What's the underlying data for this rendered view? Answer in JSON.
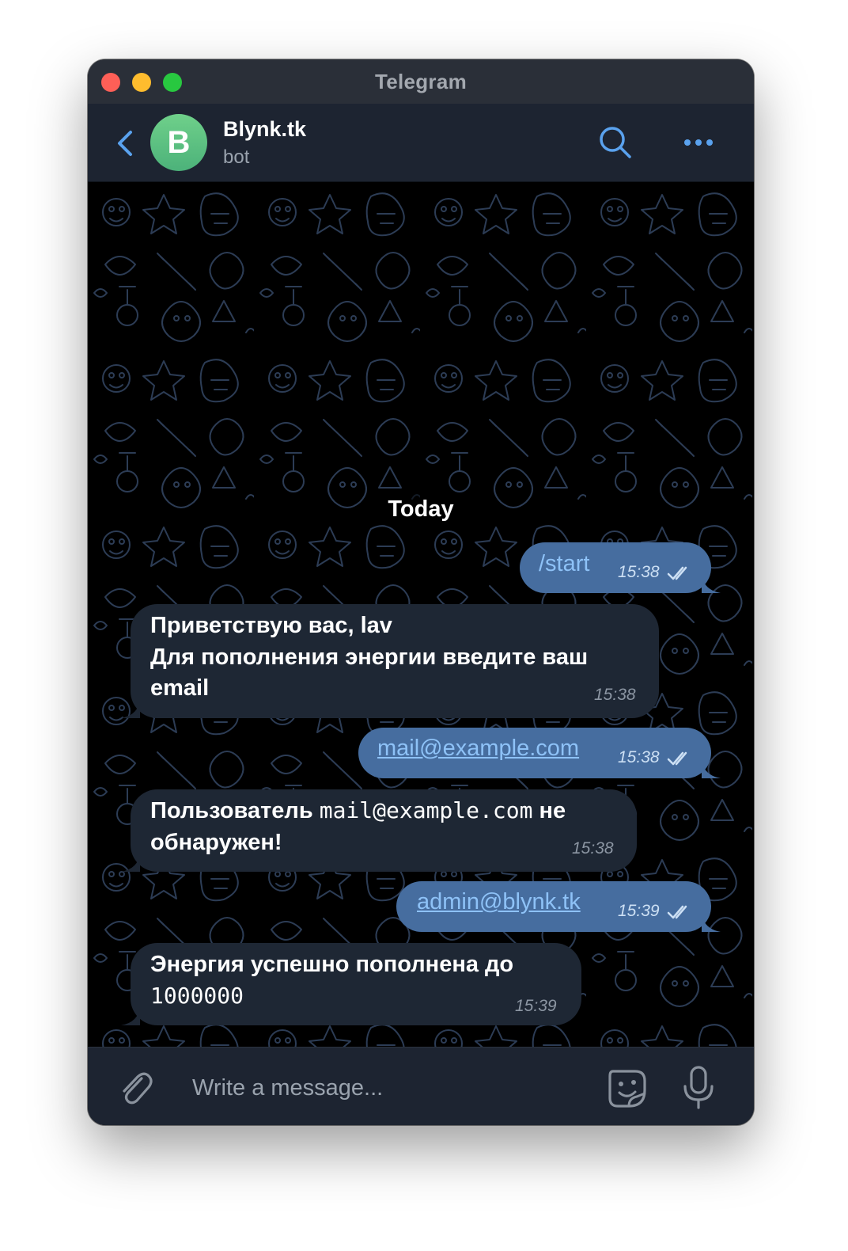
{
  "window": {
    "title": "Telegram"
  },
  "header": {
    "avatar_letter": "B",
    "chat_name": "Blynk.tk",
    "chat_status": "bot"
  },
  "chat": {
    "date_separator": "Today",
    "messages": [
      {
        "direction": "outgoing",
        "text": "/start",
        "time": "15:38",
        "read": true
      },
      {
        "direction": "incoming",
        "line1": "Приветствую вас, lav",
        "line2": "Для пополнения энергии введите ваш",
        "line3": "email",
        "time": "15:38"
      },
      {
        "direction": "outgoing",
        "link": "mail@example.com",
        "time": "15:38",
        "read": true
      },
      {
        "direction": "incoming",
        "prefix": "Пользователь",
        "code": "mail@example.com",
        "suffix": "не",
        "line2": "обнаружен!",
        "time": "15:38"
      },
      {
        "direction": "outgoing",
        "link": "admin@blynk.tk",
        "time": "15:39",
        "read": true
      },
      {
        "direction": "incoming",
        "line1": "Энергия успешно пополнена до",
        "code": "1000000",
        "time": "15:39"
      }
    ]
  },
  "composer": {
    "placeholder": "Write a message..."
  },
  "colors": {
    "accent": "#5aa2ee",
    "outgoing_bubble": "#466d9f",
    "incoming_bubble": "#1e2734",
    "header_bg": "#1d2431",
    "link": "#8ec2f7"
  },
  "icons": [
    "back-arrow-icon",
    "search-icon",
    "more-icon",
    "double-check-icon",
    "paperclip-icon",
    "sticker-icon",
    "microphone-icon"
  ]
}
